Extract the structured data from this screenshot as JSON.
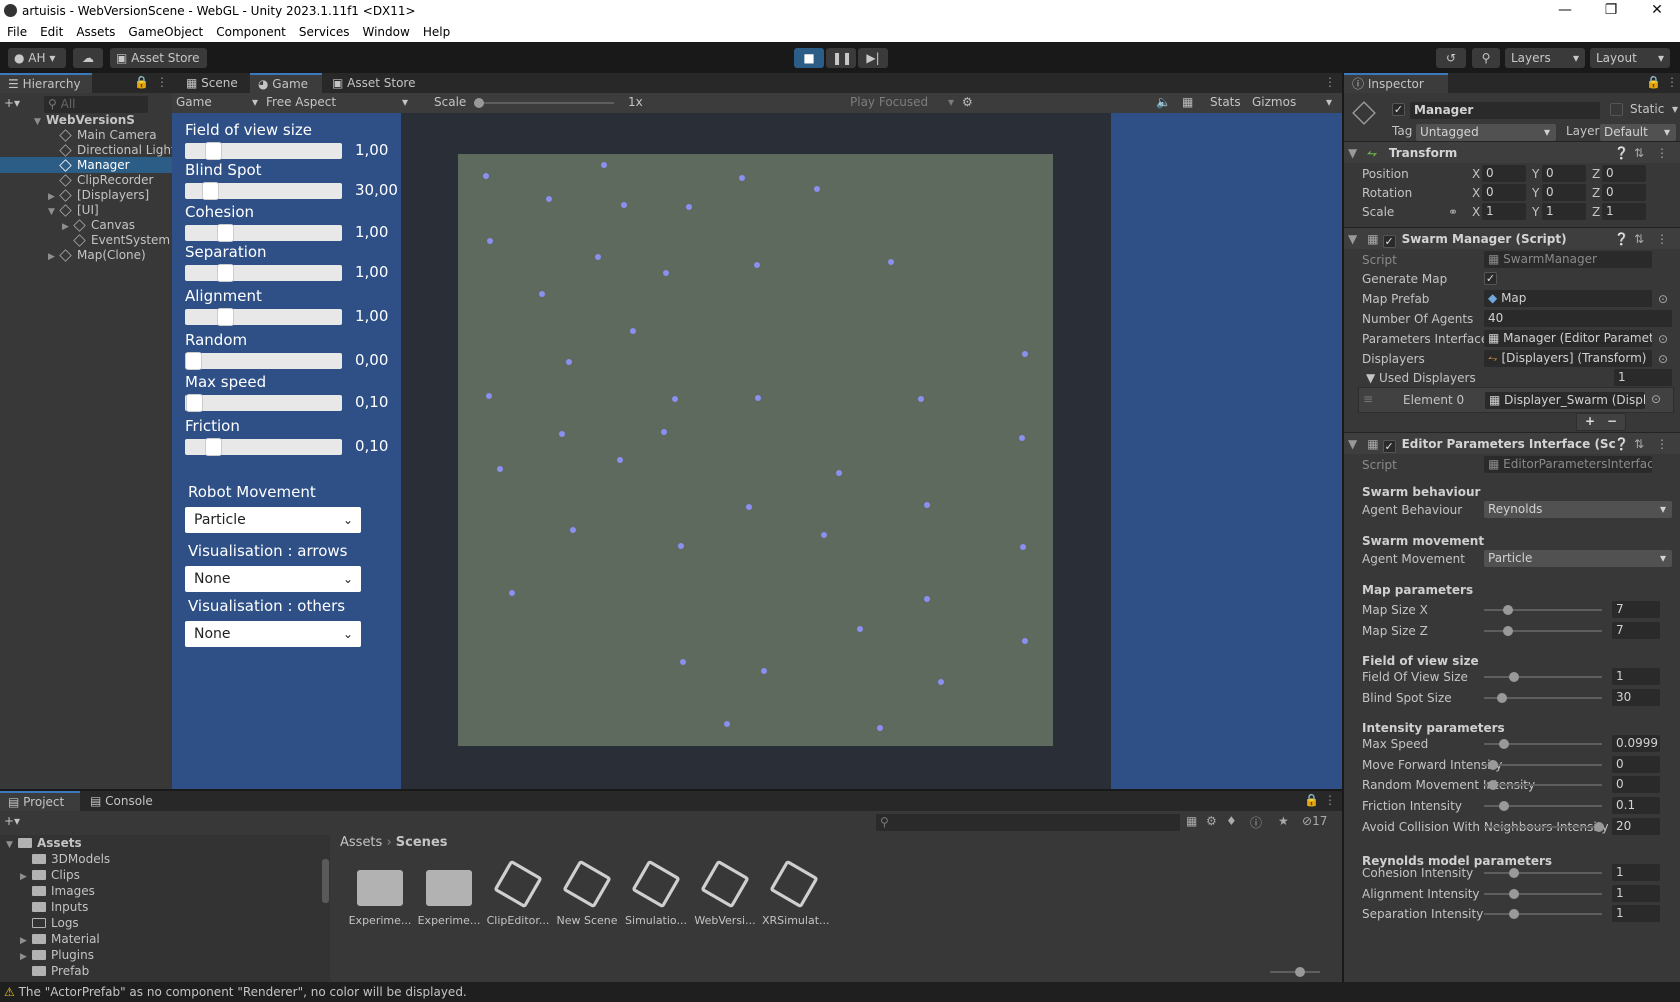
{
  "window": {
    "title": "artuisis - WebVersionScene - WebGL - Unity 2023.1.11f1 <DX11>"
  },
  "menu": [
    "File",
    "Edit",
    "Assets",
    "GameObject",
    "Component",
    "Services",
    "Window",
    "Help"
  ],
  "toolbar": {
    "account": "AH",
    "asset_store": "Asset Store",
    "layers": "Layers",
    "layout": "Layout"
  },
  "hierarchy": {
    "tab": "Hierarchy",
    "search_placeholder": "All",
    "items": [
      {
        "label": "WebVersionS",
        "root": true
      },
      {
        "label": "Main Camera"
      },
      {
        "label": "Directional Light"
      },
      {
        "label": "Manager",
        "selected": true
      },
      {
        "label": "ClipRecorder"
      },
      {
        "label": "[Displayers]"
      },
      {
        "label": "[UI]"
      },
      {
        "label": "Canvas"
      },
      {
        "label": "EventSystem"
      },
      {
        "label": "Map(Clone)"
      }
    ]
  },
  "center_tabs": [
    "Scene",
    "Game",
    "Asset Store"
  ],
  "game_toolbar": {
    "display": "Game",
    "aspect": "Free Aspect",
    "scale_label": "Scale",
    "scale_value": "1x",
    "play_focused": "Play Focused",
    "stats": "Stats",
    "gizmos": "Gizmos"
  },
  "game_ui": {
    "sliders": [
      {
        "label": "Field of view size",
        "value": "1,00",
        "level": 0.14
      },
      {
        "label": "Blind Spot",
        "value": "30,00",
        "level": 0.12
      },
      {
        "label": "Cohesion",
        "value": "1,00",
        "level": 0.23
      },
      {
        "label": "Separation",
        "value": "1,00",
        "level": 0.23
      },
      {
        "label": "Alignment",
        "value": "1,00",
        "level": 0.23
      },
      {
        "label": "Random",
        "value": "0,00",
        "level": 0.0
      },
      {
        "label": "Max speed",
        "value": "0,10",
        "level": 0.01
      },
      {
        "label": "Friction",
        "value": "0,10",
        "level": 0.14
      }
    ],
    "dropdowns": [
      {
        "label": "Robot Movement",
        "value": "Particle"
      },
      {
        "label": "Visualisation : arrows",
        "value": "None"
      },
      {
        "label": "Visualisation : others",
        "value": "None"
      }
    ]
  },
  "inspector": {
    "tab": "Inspector",
    "object_name": "Manager",
    "static": "Static",
    "tag_label": "Tag",
    "tag": "Untagged",
    "layer_label": "Layer",
    "layer": "Default",
    "transform": {
      "title": "Transform",
      "rows": [
        {
          "label": "Position",
          "x": "0",
          "y": "0",
          "z": "0"
        },
        {
          "label": "Rotation",
          "x": "0",
          "y": "0",
          "z": "0"
        },
        {
          "label": "Scale",
          "x": "1",
          "y": "1",
          "z": "1"
        }
      ]
    },
    "swarm": {
      "title": "Swarm Manager (Script)",
      "script_label": "Script",
      "script": "SwarmManager",
      "generate_map": "Generate Map",
      "map_prefab_label": "Map Prefab",
      "map_prefab": "Map",
      "agents_label": "Number Of Agents",
      "agents": "40",
      "params_label": "Parameters Interface",
      "params": "Manager (Editor Paramete",
      "displayers_label": "Displayers",
      "displayers": "[Displayers] (Transform)",
      "used_label": "Used Displayers",
      "used_count": "1",
      "element_label": "Element 0",
      "element": "Displayer_Swarm (Displa"
    },
    "editor": {
      "title": "Editor Parameters Interface (Sc",
      "script_label": "Script",
      "script": "EditorParametersInterface",
      "s1": "Swarm behaviour",
      "agent_behaviour_label": "Agent Behaviour",
      "agent_behaviour": "Reynolds",
      "s2": "Swarm movement",
      "agent_movement_label": "Agent Movement",
      "agent_movement": "Particle",
      "s3": "Map parameters",
      "s4": "Field of view size",
      "s5": "Intensity parameters",
      "s6": "Reynolds model parameters",
      "sliders": [
        {
          "label": "Map Size X",
          "value": "7",
          "level": 0.17,
          "section": 3
        },
        {
          "label": "Map Size Z",
          "value": "7",
          "level": 0.17,
          "section": 3
        },
        {
          "label": "Field Of View Size",
          "value": "1",
          "level": 0.22,
          "section": 4
        },
        {
          "label": "Blind Spot Size",
          "value": "30",
          "level": 0.12,
          "section": 4
        },
        {
          "label": "Max Speed",
          "value": "0.0999",
          "level": 0.13,
          "section": 5
        },
        {
          "label": "Move Forward Intensity",
          "value": "0",
          "level": 0.04,
          "section": 5
        },
        {
          "label": "Random Movement Intensity",
          "value": "0",
          "level": 0.04,
          "section": 5
        },
        {
          "label": "Friction Intensity",
          "value": "0.1",
          "level": 0.13,
          "section": 5
        },
        {
          "label": "Avoid Collision With Neighbours Intensity",
          "value": "20",
          "level": 0.98,
          "section": 5
        },
        {
          "label": "Cohesion Intensity",
          "value": "1",
          "level": 0.22,
          "section": 6
        },
        {
          "label": "Alignment Intensity",
          "value": "1",
          "level": 0.22,
          "section": 6
        },
        {
          "label": "Separation Intensity",
          "value": "1",
          "level": 0.22,
          "section": 6
        }
      ]
    }
  },
  "project": {
    "tabs": [
      "Project",
      "Console"
    ],
    "tree": [
      "Assets",
      "3DModels",
      "Clips",
      "Images",
      "Inputs",
      "Logs",
      "Material",
      "Plugins",
      "Prefab"
    ],
    "breadcrumb": [
      "Assets",
      "Scenes"
    ],
    "count": "17",
    "assets": [
      {
        "label": "Experime...",
        "kind": "folder"
      },
      {
        "label": "Experime...",
        "kind": "folder"
      },
      {
        "label": "ClipEditor...",
        "kind": "unity"
      },
      {
        "label": "New Scene",
        "kind": "unity"
      },
      {
        "label": "Simulatio...",
        "kind": "unity"
      },
      {
        "label": "WebVersi...",
        "kind": "unity"
      },
      {
        "label": "XRSimulat...",
        "kind": "unity"
      }
    ]
  },
  "status": {
    "message": "The \"ActorPrefab\" as no component \"Renderer\", no color will be displayed."
  },
  "colors": {
    "accent": "#2c5d87",
    "game_panel": "#2e5087",
    "map": "#5e6a5e",
    "agent": "#8a8ff0"
  }
}
